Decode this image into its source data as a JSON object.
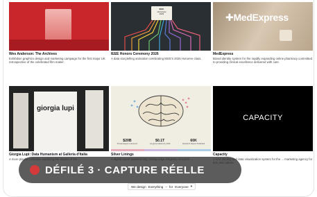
{
  "cards": [
    {
      "title": "Wes Anderson: The Archives",
      "desc": "Exhibition graphics design and marketing campaign for the first major UK retrospective of the celebrated film maker."
    },
    {
      "title": "IEEE Honors Ceremony 2026",
      "desc": "A data storytelling animation celebrating IEEE's 2026 Honoree class.",
      "thumb_lines": [
        "IEEE",
        "Honorees",
        "2026"
      ]
    },
    {
      "title": "MedExpress",
      "desc": "Brand identity system for the rapidly expanding online pharmacy committed to providing clinical excellence delivered with care.",
      "logo": "MedExpress"
    },
    {
      "title": "Giorgia Lupi: Data Humanism at Galleria d'Italia",
      "desc": "A more playful exhibition exploring the lauded of the ...",
      "thumb_name": "giorgia lupi"
    },
    {
      "title": "Silver Linings",
      "desc": "A digital report transforming cutting-edge longevity research ...",
      "stats": [
        {
          "value": "$20B",
          "label": "Private Equity Investment"
        },
        {
          "value": "$0.1T",
          "label": "Longevity Market by 2030"
        },
        {
          "value": "60K",
          "label": "Research Papers Published"
        }
      ]
    },
    {
      "title": "Capacity",
      "desc": "A new identity and data visualization system for the ... marketing agency for arts and culture.",
      "word": "CAPACITY"
    }
  ],
  "banner": {
    "label": "DÉFILÉ 3 · CAPTURE RÉELLE"
  },
  "bottom_bar": {
    "lead": "We design",
    "choice": "Everything",
    "sep": "–",
    "for": "for",
    "audience": "Everyone",
    "caret": "▾"
  },
  "colors": {
    "banner_bg": "#2e2e2e",
    "rec_dot": "#d43a3a"
  }
}
